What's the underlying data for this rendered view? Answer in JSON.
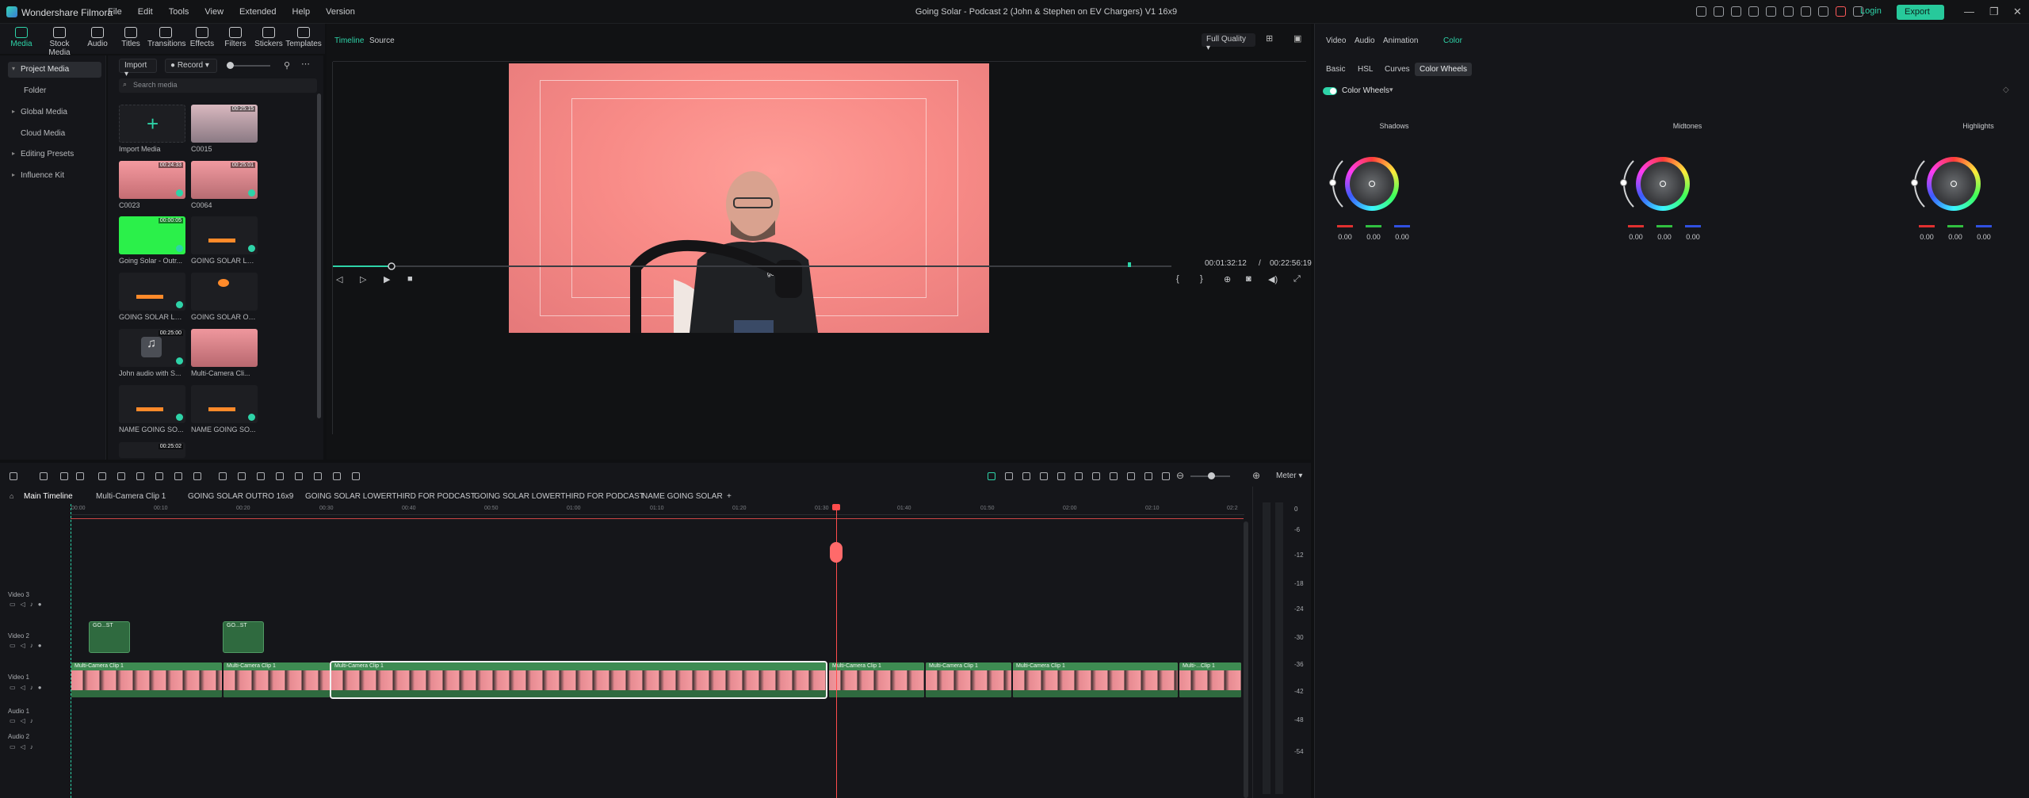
{
  "titlebar": {
    "app": "Wondershare Filmora",
    "menu": [
      "File",
      "Edit",
      "Tools",
      "View",
      "Extended",
      "Help",
      "Version"
    ],
    "doc_title": "Going Solar - Podcast 2 (John & Stephen on EV Chargers) V1 16x9",
    "login": "Login",
    "export": "Export"
  },
  "left_tools": [
    "Media",
    "Stock Media",
    "Audio",
    "Titles",
    "Transitions",
    "Effects",
    "Filters",
    "Stickers",
    "Templates"
  ],
  "left_nav": [
    "Project Media",
    "Folder",
    "Global Media",
    "Cloud Media",
    "Editing Presets",
    "Influence Kit"
  ],
  "media": {
    "import": "Import",
    "record": "Record",
    "search_placeholder": "Search media",
    "import_media": "Import Media",
    "items": [
      {
        "label": "C0015",
        "dur": "00:25:15"
      },
      {
        "label": "C0023",
        "dur": "00:24:33"
      },
      {
        "label": "C0064",
        "dur": "00:25:01"
      },
      {
        "label": "Going Solar - Outr...",
        "dur": "00:00:05"
      },
      {
        "label": "GOING SOLAR LO...",
        "dur": ""
      },
      {
        "label": "GOING SOLAR LO...",
        "dur": ""
      },
      {
        "label": "GOING SOLAR OU...",
        "dur": ""
      },
      {
        "label": "John audio with S...",
        "dur": "00:25:00"
      },
      {
        "label": "Multi-Camera Cli...",
        "dur": ""
      },
      {
        "label": "NAME GOING SO...",
        "dur": ""
      },
      {
        "label": "NAME GOING SO...",
        "dur": ""
      },
      {
        "label": "",
        "dur": "00:25:02"
      }
    ]
  },
  "player": {
    "tab_timeline": "Timeline",
    "tab_source": "Source",
    "quality": "Full Quality",
    "current_time": "00:01:32:12",
    "separator": "/",
    "total_time": "00:22:56:19",
    "progress": 0.07
  },
  "right": {
    "tabs": [
      "Video",
      "Audio",
      "Animation",
      "Color"
    ],
    "subtabs": [
      "Basic",
      "HSL",
      "Curves",
      "Color Wheels"
    ],
    "section": "Color Wheels",
    "wheels": [
      {
        "name": "Shadows",
        "r": "0.00",
        "g": "0.00",
        "b": "0.00"
      },
      {
        "name": "Midtones",
        "r": "0.00",
        "g": "0.00",
        "b": "0.00"
      },
      {
        "name": "Highlights",
        "r": "0.00",
        "g": "0.00",
        "b": "0.00"
      }
    ]
  },
  "timeline": {
    "tabs": [
      "Main Timeline",
      "Multi-Camera Clip 1",
      "GOING SOLAR OUTRO 16x9",
      "GOING SOLAR LOWERTHIRD FOR PODCAST",
      "GOING SOLAR LOWERTHIRD FOR PODCAST",
      "NAME GOING SOLAR"
    ],
    "meter_label": "Meter",
    "ticks": [
      "00:00",
      "00:10",
      "00:20",
      "00:30",
      "00:40",
      "00:50",
      "01:00",
      "01:10",
      "01:20",
      "01:30",
      "01:40",
      "01:50",
      "02:00",
      "02:10",
      "02:2"
    ],
    "tracks": [
      "Video 3",
      "Video 2",
      "Video 1",
      "Audio 1",
      "Audio 2"
    ],
    "v2_clips": [
      "GO...ST",
      "GO...ST"
    ],
    "v1_clips": [
      "Multi-Camera Clip 1",
      "Multi-Camera Clip 1",
      "Multi-Camera Clip 1",
      "Multi-Camera Clip 1",
      "Multi-Camera Clip 1",
      "Multi-Camera Clip 1",
      "Multi-...Clip 1"
    ],
    "meter_scale": [
      "0",
      "-6",
      "-12",
      "-18",
      "-24",
      "-30",
      "-36",
      "-42",
      "-48",
      "-54"
    ]
  },
  "colors": {
    "accent": "#2ed3a8",
    "playhead": "#ff4d4d",
    "clip": "#3e8b52"
  }
}
